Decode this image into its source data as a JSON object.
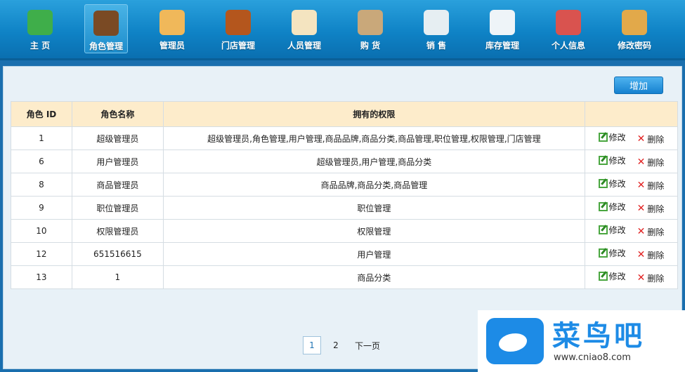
{
  "nav": {
    "items": [
      {
        "label": "主  页",
        "icon": "home-icon",
        "color": "#3fae4a"
      },
      {
        "label": "角色管理",
        "icon": "waiter-icon",
        "color": "#7a4a24",
        "active": true
      },
      {
        "label": "管理员",
        "icon": "admin-user-icon",
        "color": "#f0b85a"
      },
      {
        "label": "门店管理",
        "icon": "store-icon",
        "color": "#b4561d"
      },
      {
        "label": "人员管理",
        "icon": "id-card-icon",
        "color": "#f4e4c0"
      },
      {
        "label": "购  货",
        "icon": "clipboard-icon",
        "color": "#c9a87a"
      },
      {
        "label": "销  售",
        "icon": "chart-doc-icon",
        "color": "#e6eef2"
      },
      {
        "label": "库存管理",
        "icon": "document-icon",
        "color": "#eef4f8"
      },
      {
        "label": "个人信息",
        "icon": "users-icon",
        "color": "#d9534f"
      },
      {
        "label": "修改密码",
        "icon": "lock-user-icon",
        "color": "#e2a94a"
      }
    ]
  },
  "toolbar": {
    "add_label": "增加"
  },
  "table": {
    "headers": [
      "角色 ID",
      "角色名称",
      "拥有的权限",
      ""
    ],
    "edit_label": "修改",
    "delete_label": "删除",
    "rows": [
      {
        "id": "1",
        "name": "超级管理员",
        "perms": "超级管理员,角色管理,用户管理,商品品牌,商品分类,商品管理,职位管理,权限管理,门店管理"
      },
      {
        "id": "6",
        "name": "用户管理员",
        "perms": "超级管理员,用户管理,商品分类"
      },
      {
        "id": "8",
        "name": "商品管理员",
        "perms": "商品品牌,商品分类,商品管理"
      },
      {
        "id": "9",
        "name": "职位管理员",
        "perms": "职位管理"
      },
      {
        "id": "10",
        "name": "权限管理员",
        "perms": "权限管理"
      },
      {
        "id": "12",
        "name": "651516615",
        "perms": "用户管理"
      },
      {
        "id": "13",
        "name": "1",
        "perms": "商品分类"
      }
    ]
  },
  "pager": {
    "current": "1",
    "page2": "2",
    "next": "下一页"
  },
  "watermark": {
    "cn": "菜鸟吧",
    "en": "www.cniao8.com"
  }
}
